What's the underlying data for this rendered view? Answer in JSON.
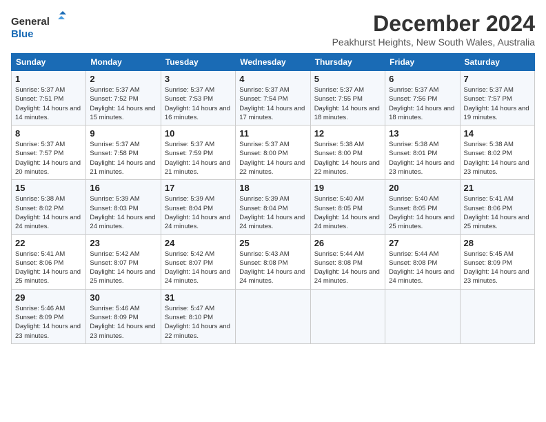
{
  "logo": {
    "line1": "General",
    "line2": "Blue"
  },
  "title": "December 2024",
  "location": "Peakhurst Heights, New South Wales, Australia",
  "weekdays": [
    "Sunday",
    "Monday",
    "Tuesday",
    "Wednesday",
    "Thursday",
    "Friday",
    "Saturday"
  ],
  "weeks": [
    [
      {
        "day": "1",
        "sunrise": "5:37 AM",
        "sunset": "7:51 PM",
        "daylight": "14 hours and 14 minutes."
      },
      {
        "day": "2",
        "sunrise": "5:37 AM",
        "sunset": "7:52 PM",
        "daylight": "14 hours and 15 minutes."
      },
      {
        "day": "3",
        "sunrise": "5:37 AM",
        "sunset": "7:53 PM",
        "daylight": "14 hours and 16 minutes."
      },
      {
        "day": "4",
        "sunrise": "5:37 AM",
        "sunset": "7:54 PM",
        "daylight": "14 hours and 17 minutes."
      },
      {
        "day": "5",
        "sunrise": "5:37 AM",
        "sunset": "7:55 PM",
        "daylight": "14 hours and 18 minutes."
      },
      {
        "day": "6",
        "sunrise": "5:37 AM",
        "sunset": "7:56 PM",
        "daylight": "14 hours and 18 minutes."
      },
      {
        "day": "7",
        "sunrise": "5:37 AM",
        "sunset": "7:57 PM",
        "daylight": "14 hours and 19 minutes."
      }
    ],
    [
      {
        "day": "8",
        "sunrise": "5:37 AM",
        "sunset": "7:57 PM",
        "daylight": "14 hours and 20 minutes."
      },
      {
        "day": "9",
        "sunrise": "5:37 AM",
        "sunset": "7:58 PM",
        "daylight": "14 hours and 21 minutes."
      },
      {
        "day": "10",
        "sunrise": "5:37 AM",
        "sunset": "7:59 PM",
        "daylight": "14 hours and 21 minutes."
      },
      {
        "day": "11",
        "sunrise": "5:37 AM",
        "sunset": "8:00 PM",
        "daylight": "14 hours and 22 minutes."
      },
      {
        "day": "12",
        "sunrise": "5:38 AM",
        "sunset": "8:00 PM",
        "daylight": "14 hours and 22 minutes."
      },
      {
        "day": "13",
        "sunrise": "5:38 AM",
        "sunset": "8:01 PM",
        "daylight": "14 hours and 23 minutes."
      },
      {
        "day": "14",
        "sunrise": "5:38 AM",
        "sunset": "8:02 PM",
        "daylight": "14 hours and 23 minutes."
      }
    ],
    [
      {
        "day": "15",
        "sunrise": "5:38 AM",
        "sunset": "8:02 PM",
        "daylight": "14 hours and 24 minutes."
      },
      {
        "day": "16",
        "sunrise": "5:39 AM",
        "sunset": "8:03 PM",
        "daylight": "14 hours and 24 minutes."
      },
      {
        "day": "17",
        "sunrise": "5:39 AM",
        "sunset": "8:04 PM",
        "daylight": "14 hours and 24 minutes."
      },
      {
        "day": "18",
        "sunrise": "5:39 AM",
        "sunset": "8:04 PM",
        "daylight": "14 hours and 24 minutes."
      },
      {
        "day": "19",
        "sunrise": "5:40 AM",
        "sunset": "8:05 PM",
        "daylight": "14 hours and 24 minutes."
      },
      {
        "day": "20",
        "sunrise": "5:40 AM",
        "sunset": "8:05 PM",
        "daylight": "14 hours and 25 minutes."
      },
      {
        "day": "21",
        "sunrise": "5:41 AM",
        "sunset": "8:06 PM",
        "daylight": "14 hours and 25 minutes."
      }
    ],
    [
      {
        "day": "22",
        "sunrise": "5:41 AM",
        "sunset": "8:06 PM",
        "daylight": "14 hours and 25 minutes."
      },
      {
        "day": "23",
        "sunrise": "5:42 AM",
        "sunset": "8:07 PM",
        "daylight": "14 hours and 25 minutes."
      },
      {
        "day": "24",
        "sunrise": "5:42 AM",
        "sunset": "8:07 PM",
        "daylight": "14 hours and 24 minutes."
      },
      {
        "day": "25",
        "sunrise": "5:43 AM",
        "sunset": "8:08 PM",
        "daylight": "14 hours and 24 minutes."
      },
      {
        "day": "26",
        "sunrise": "5:44 AM",
        "sunset": "8:08 PM",
        "daylight": "14 hours and 24 minutes."
      },
      {
        "day": "27",
        "sunrise": "5:44 AM",
        "sunset": "8:08 PM",
        "daylight": "14 hours and 24 minutes."
      },
      {
        "day": "28",
        "sunrise": "5:45 AM",
        "sunset": "8:09 PM",
        "daylight": "14 hours and 23 minutes."
      }
    ],
    [
      {
        "day": "29",
        "sunrise": "5:46 AM",
        "sunset": "8:09 PM",
        "daylight": "14 hours and 23 minutes."
      },
      {
        "day": "30",
        "sunrise": "5:46 AM",
        "sunset": "8:09 PM",
        "daylight": "14 hours and 23 minutes."
      },
      {
        "day": "31",
        "sunrise": "5:47 AM",
        "sunset": "8:10 PM",
        "daylight": "14 hours and 22 minutes."
      },
      null,
      null,
      null,
      null
    ]
  ],
  "labels": {
    "sunrise": "Sunrise:",
    "sunset": "Sunset:",
    "daylight": "Daylight:"
  }
}
